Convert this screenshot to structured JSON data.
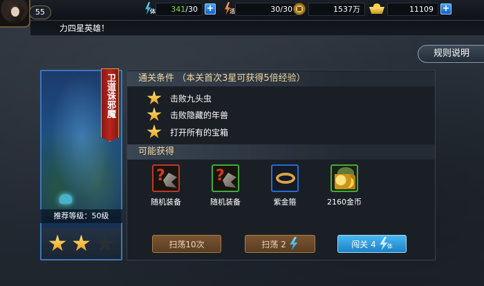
{
  "topbar": {
    "level": "55",
    "stamina": {
      "icon": "stamina-bolt-icon",
      "icon_label": "体",
      "current": "341",
      "max": "/30",
      "current_color": "#7be04a"
    },
    "vigor": {
      "icon": "vigor-bolt-icon",
      "icon_label": "活",
      "value": "30/30"
    },
    "coins": {
      "icon": "copper-coin-icon",
      "value": "1537万"
    },
    "ingots": {
      "icon": "gold-ingot-icon",
      "value": "11109"
    },
    "plus_label": "+"
  },
  "ticker": {
    "text": "力四星英雄！"
  },
  "help_button": {
    "label": "规则说明"
  },
  "stage": {
    "name": "卫道诛邪魔",
    "recommended_level": "推荐等级：50级",
    "stars_earned": 2,
    "stars_total": 3
  },
  "conditions": {
    "title": "通关条件 （本关首次3星可获得5倍经验）",
    "items": [
      {
        "label": "击败九头虫"
      },
      {
        "label": "击败隐藏的年兽"
      },
      {
        "label": "打开所有的宝箱"
      }
    ]
  },
  "rewards": {
    "title": "可能获得",
    "items": [
      {
        "label": "随机装备",
        "icon": "random-equipment-icon"
      },
      {
        "label": "随机装备",
        "icon": "random-equipment-icon"
      },
      {
        "label": "紫金箍",
        "icon": "golden-hoop-icon"
      },
      {
        "label": "2160金币",
        "icon": "gold-coins-icon"
      }
    ]
  },
  "actions": {
    "sweep10": "扫荡10次",
    "sweep": "扫荡 2",
    "challenge": "闯关 4",
    "cost_icon_label": "体"
  },
  "colors": {
    "accent_blue": "#1c82c8",
    "title_gold": "#f0d7a0",
    "banner_red": "#b8261c"
  }
}
